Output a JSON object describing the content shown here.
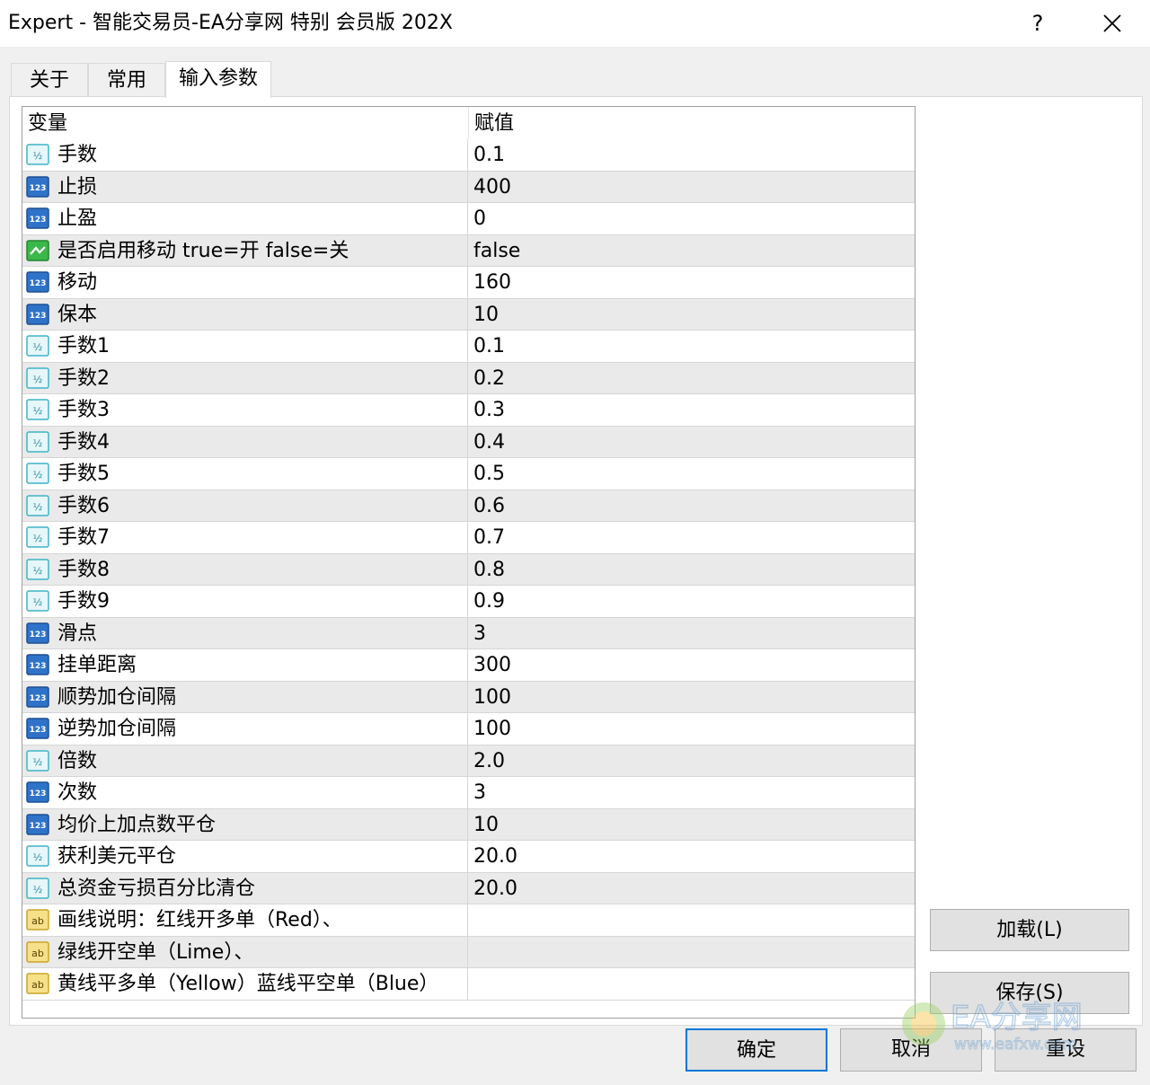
{
  "window": {
    "title": "Expert - 智能交易员-EA分享网 特别 会员版 202X",
    "help_label": "?"
  },
  "tabs": [
    {
      "label": "关于"
    },
    {
      "label": "常用"
    },
    {
      "label": "输入参数"
    }
  ],
  "grid": {
    "columns": {
      "variable": "变量",
      "value": "赋值"
    },
    "rows": [
      {
        "type": "double",
        "name": "手数",
        "value": "0.1"
      },
      {
        "type": "int",
        "name": "止损",
        "value": "400"
      },
      {
        "type": "int",
        "name": "止盈",
        "value": "0"
      },
      {
        "type": "bool",
        "name": "是否启用移动    true=开    false=关",
        "value": "false"
      },
      {
        "type": "int",
        "name": "移动",
        "value": "160"
      },
      {
        "type": "int",
        "name": "保本",
        "value": "10"
      },
      {
        "type": "double",
        "name": "手数1",
        "value": "0.1"
      },
      {
        "type": "double",
        "name": "手数2",
        "value": "0.2"
      },
      {
        "type": "double",
        "name": "手数3",
        "value": "0.3"
      },
      {
        "type": "double",
        "name": "手数4",
        "value": "0.4"
      },
      {
        "type": "double",
        "name": "手数5",
        "value": "0.5"
      },
      {
        "type": "double",
        "name": "手数6",
        "value": "0.6"
      },
      {
        "type": "double",
        "name": "手数7",
        "value": "0.7"
      },
      {
        "type": "double",
        "name": "手数8",
        "value": "0.8"
      },
      {
        "type": "double",
        "name": "手数9",
        "value": "0.9"
      },
      {
        "type": "int",
        "name": "滑点",
        "value": "3"
      },
      {
        "type": "int",
        "name": "挂单距离",
        "value": "300"
      },
      {
        "type": "int",
        "name": "顺势加仓间隔",
        "value": "100"
      },
      {
        "type": "int",
        "name": "逆势加仓间隔",
        "value": "100"
      },
      {
        "type": "double",
        "name": "倍数",
        "value": "2.0"
      },
      {
        "type": "int",
        "name": "次数",
        "value": "3"
      },
      {
        "type": "int",
        "name": "均价上加点数平仓",
        "value": "10"
      },
      {
        "type": "double",
        "name": "获利美元平仓",
        "value": "20.0"
      },
      {
        "type": "double",
        "name": "总资金亏损百分比清仓",
        "value": "20.0"
      },
      {
        "type": "string",
        "name": "画线说明：红线开多单（Red）、",
        "value": ""
      },
      {
        "type": "string",
        "name": "绿线开空单（Lime）、",
        "value": ""
      },
      {
        "type": "string",
        "name": "黄线平多单（Yellow）蓝线平空单（Blue）",
        "value": ""
      }
    ]
  },
  "buttons": {
    "load": "加载(L)",
    "save": "保存(S)",
    "ok": "确定",
    "cancel": "取消",
    "reset": "重设"
  },
  "watermark": {
    "line1": "EA分享网",
    "line2": "www.eafxw.com"
  },
  "icon_names": {
    "double": "fraction-icon",
    "int": "integer-icon",
    "bool": "boolean-icon",
    "string": "string-icon"
  },
  "colors": {
    "focus_border": "#0078d7",
    "alt_row": "#eaeaea"
  }
}
